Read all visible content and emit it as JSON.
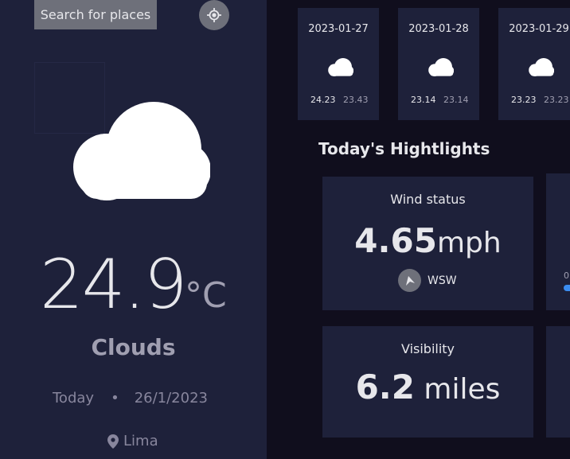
{
  "sidebar": {
    "search_label": "Search for places",
    "current_icon": "cloud-icon",
    "temperature": "24.9",
    "unit": "°C",
    "condition": "Clouds",
    "date_prefix": "Today",
    "separator": "•",
    "date": "26/1/2023",
    "location": "Lima"
  },
  "forecast": [
    {
      "date": "2023-01-27",
      "icon": "cloud-icon",
      "max": "24.23",
      "min": "23.43"
    },
    {
      "date": "2023-01-28",
      "icon": "cloud-icon",
      "max": "23.14",
      "min": "23.14"
    },
    {
      "date": "2023-01-29",
      "icon": "cloud-icon",
      "max": "23.23",
      "min": "23.23"
    }
  ],
  "highlights": {
    "title": "Today's Hightlights",
    "wind": {
      "label": "Wind status",
      "value": "4.65",
      "unit": "mph",
      "direction": "WSW"
    },
    "visibility": {
      "label": "Visibility",
      "value": "6.2",
      "unit": " miles"
    },
    "humidity_scale_start": "0"
  },
  "colors": {
    "background": "#100e1d",
    "panel": "#1e213a",
    "button": "#6e707a",
    "accent": "#3b8df1"
  }
}
